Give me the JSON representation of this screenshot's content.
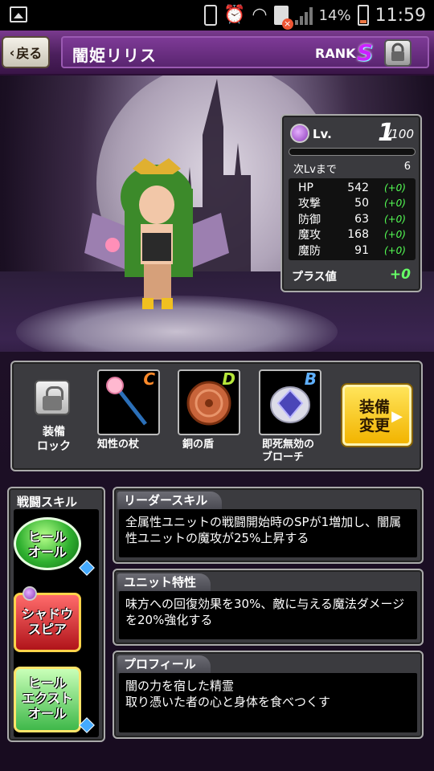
{
  "status_bar": {
    "battery_pct": "14%",
    "time": "11:59"
  },
  "header": {
    "back_label": "戻る",
    "title": "闇姫リリス",
    "rank_label": "RANK",
    "rank_value": "S"
  },
  "stats": {
    "lv_label": "Lv.",
    "lv_current": "1",
    "lv_max": "/100",
    "next_label": "次Lvまで",
    "next_value": "6",
    "rows": [
      {
        "name": "HP",
        "value": "542",
        "plus": "(+0)"
      },
      {
        "name": "攻撃",
        "value": "50",
        "plus": "(+0)"
      },
      {
        "name": "防御",
        "value": "63",
        "plus": "(+0)"
      },
      {
        "name": "魔攻",
        "value": "168",
        "plus": "(+0)"
      },
      {
        "name": "魔防",
        "value": "91",
        "plus": "(+0)"
      }
    ],
    "plus_label": "プラス値",
    "plus_value": "+0"
  },
  "equipment": {
    "lock_label": "装備\nロック",
    "slots": [
      {
        "name": "知性の杖",
        "rank": "C",
        "rank_color": "#ff8a2a"
      },
      {
        "name": "銅の盾",
        "rank": "D",
        "rank_color": "#b6e63a"
      },
      {
        "name": "即死無効の\nブローチ",
        "rank": "B",
        "rank_color": "#5fb0ff"
      }
    ],
    "change_label": "装備\n変更"
  },
  "battle_skills": {
    "title": "戦闘スキル",
    "skills": [
      {
        "name": "ヒール\nオール"
      },
      {
        "name": "シャドウ\nスピア"
      },
      {
        "name": "ヒール\nエクスト\nオール"
      }
    ]
  },
  "leader_skill": {
    "title": "リーダースキル",
    "text": "全属性ユニットの戦闘開始時のSPが1増加し、闇属性ユニットの魔攻が25%上昇する"
  },
  "unit_trait": {
    "title": "ユニット特性",
    "text": "味方への回復効果を30%、敵に与える魔法ダメージを20%強化する"
  },
  "profile": {
    "title": "プロフィール",
    "text": "闇の力を宿した精霊\n取り憑いた者の心と身体を食べつくす"
  }
}
